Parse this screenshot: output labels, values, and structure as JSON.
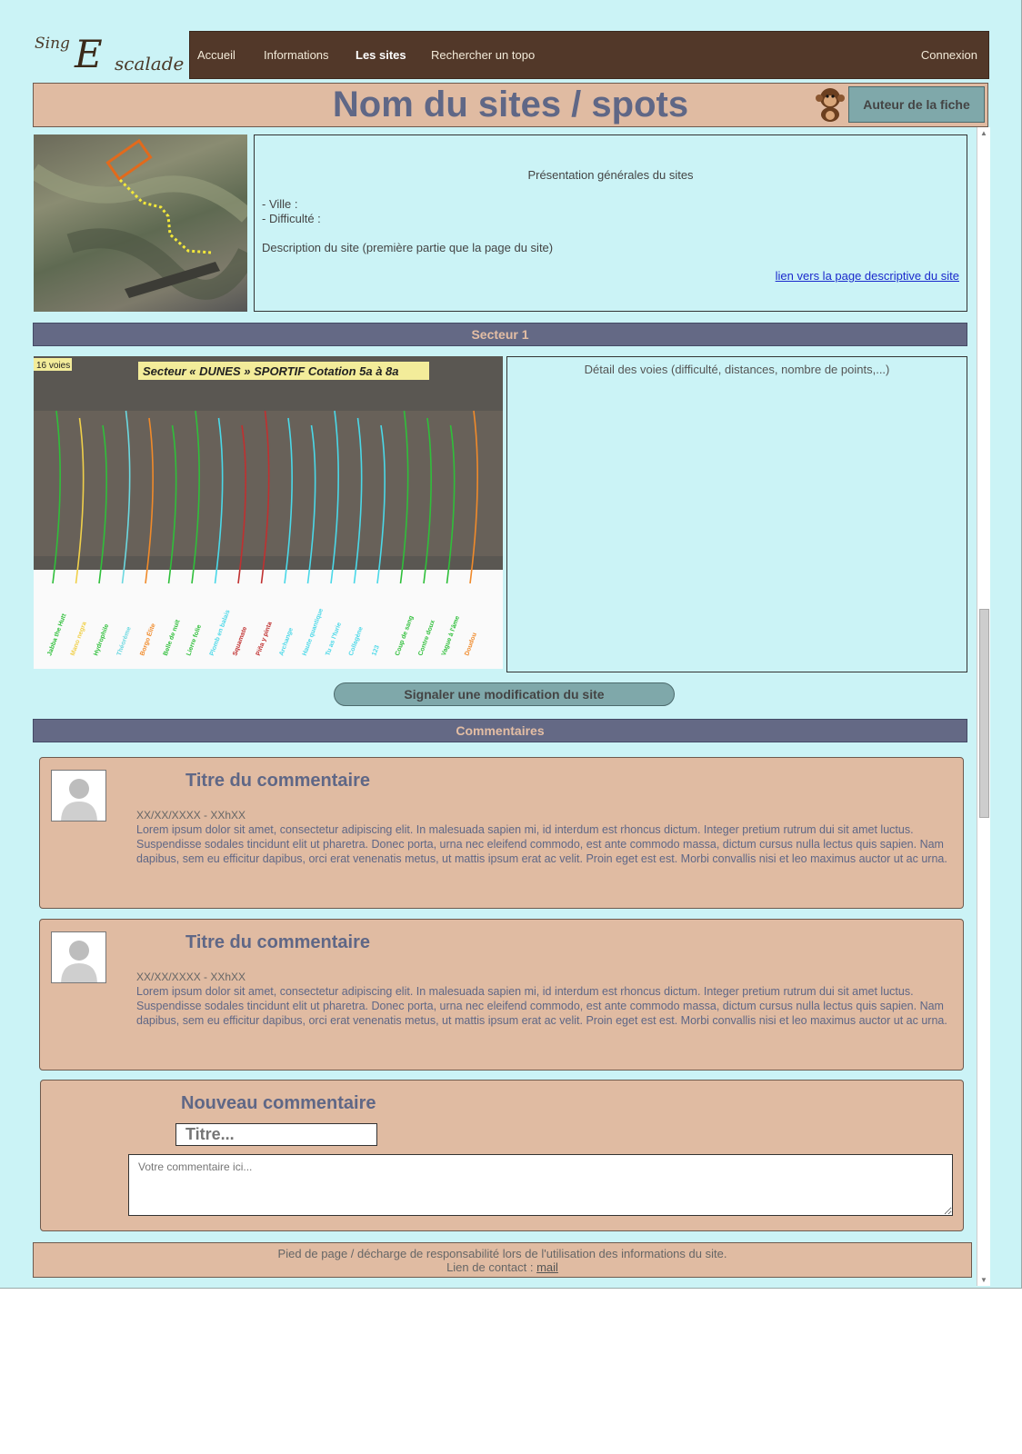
{
  "logo": {
    "part1": "Sing",
    "part2": "E",
    "part3": "scalade"
  },
  "nav": {
    "items": [
      "Accueil",
      "Informations",
      "Les sites",
      "Rechercher un topo"
    ],
    "login": "Connexion"
  },
  "header": {
    "title": "Nom du sites / spots",
    "author_button": "Auteur de la fiche"
  },
  "site": {
    "presentation": "Présentation générales du sites",
    "ville": "- Ville :",
    "difficulte": "- Difficulté :",
    "description": "Description du site (première partie que la page du site)",
    "link": "lien vers la page descriptive du site"
  },
  "sector": {
    "title": "Secteur 1",
    "photo_caption": "Secteur « DUNES » SPORTIF Cotation 5a à 8a",
    "route_count": "16 voies",
    "detail": "Détail des voies (difficulté, distances, nombre de points,...)",
    "route_names": [
      "Jabba the Hutt",
      "Mano negra",
      "Hydrophile",
      "Théorème",
      "Borgo Élite",
      "Belle de nuit",
      "Lierre folie",
      "Plomb en balais",
      "Squamate",
      "Piña y pinta",
      "Archange",
      "Haute quantique",
      "Tu as l'furie",
      "Collagène",
      "123",
      "Coup de sang",
      "Contre doux",
      "Vague à l'âme",
      "Doudou"
    ]
  },
  "report_button": "Signaler une modification du site",
  "comments": {
    "title": "Commentaires",
    "items": [
      {
        "title": "Titre du commentaire",
        "date": "XX/XX/XXXX - XXhXX",
        "text": "Lorem ipsum dolor sit amet, consectetur adipiscing elit. In malesuada sapien mi, id interdum est rhoncus dictum. Integer pretium rutrum dui sit amet luctus. Suspendisse sodales tincidunt elit ut pharetra. Donec porta, urna nec eleifend commodo, est ante commodo massa, dictum cursus nulla lectus quis sapien. Nam dapibus, sem eu efficitur dapibus, orci erat venenatis metus, ut mattis ipsum erat ac velit. Proin eget est est. Morbi convallis nisi et leo maximus auctor ut ac urna."
      },
      {
        "title": "Titre du commentaire",
        "date": "XX/XX/XXXX - XXhXX",
        "text": "Lorem ipsum dolor sit amet, consectetur adipiscing elit. In malesuada sapien mi, id interdum est rhoncus dictum. Integer pretium rutrum dui sit amet luctus. Suspendisse sodales tincidunt elit ut pharetra. Donec porta, urna nec eleifend commodo, est ante commodo massa, dictum cursus nulla lectus quis sapien. Nam dapibus, sem eu efficitur dapibus, orci erat venenatis metus, ut mattis ipsum erat ac velit. Proin eget est est. Morbi convallis nisi et leo maximus auctor ut ac urna."
      }
    ]
  },
  "new_comment": {
    "title": "Nouveau commentaire",
    "title_placeholder": "Titre...",
    "text_placeholder": "Votre commentaire ici..."
  },
  "footer": {
    "disclaimer": "Pied de page / décharge de responsabilité lors de l'utilisation des informations du site.",
    "contact_label": "Lien de contact :",
    "contact_link": "mail"
  },
  "icons": [
    "monkey-icon",
    "avatar-icon",
    "scroll-up-icon",
    "scroll-down-icon"
  ]
}
